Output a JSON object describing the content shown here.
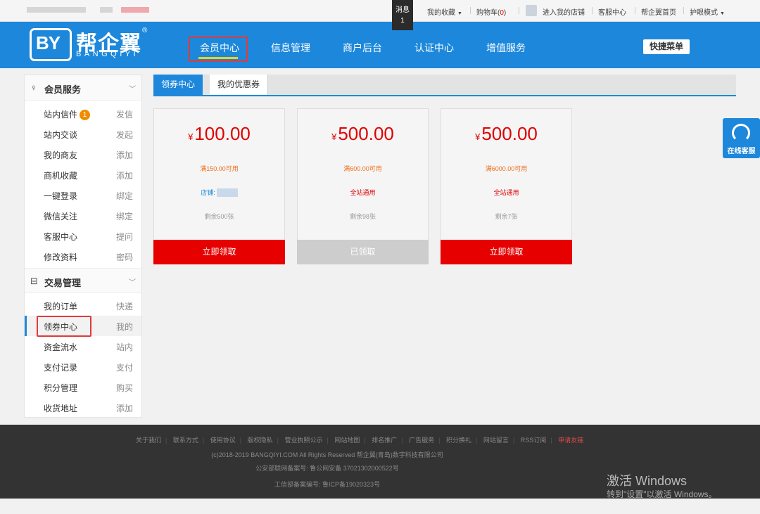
{
  "topbar": {
    "msg_label": "消息",
    "msg_count": "1",
    "my_fav": "我的收藏",
    "cart_label": "购物车(",
    "cart_count": "0",
    "cart_close": ")",
    "enter_shop": "进入我的店铺",
    "service": "客服中心",
    "home": "帮企翼首页",
    "eye_mode": "护眼模式"
  },
  "header": {
    "logo_mark": "BY",
    "logo_cn": "帮企翼",
    "logo_en": "BANGQIYI",
    "logo_reg": "®",
    "nav": [
      "会员中心",
      "信息管理",
      "商户后台",
      "认证中心",
      "增值服务"
    ],
    "quick_menu": "快捷菜单"
  },
  "sidebar": {
    "section1": {
      "title": "会员服务",
      "icon": "user-icon"
    },
    "items1": [
      {
        "label": "站内信件",
        "badge": "1",
        "action": "发信"
      },
      {
        "label": "站内交谈",
        "action": "发起"
      },
      {
        "label": "我的商友",
        "action": "添加"
      },
      {
        "label": "商机收藏",
        "action": "添加"
      },
      {
        "label": "一键登录",
        "action": "绑定"
      },
      {
        "label": "微信关注",
        "action": "绑定"
      },
      {
        "label": "客服中心",
        "action": "提问"
      },
      {
        "label": "修改资料",
        "action": "密码"
      }
    ],
    "section2": {
      "title": "交易管理",
      "icon": "order-icon"
    },
    "items2": [
      {
        "label": "我的订单",
        "action": "快递"
      },
      {
        "label": "领券中心",
        "action": "我的"
      },
      {
        "label": "资金流水",
        "action": "站内"
      },
      {
        "label": "支付记录",
        "action": "支付"
      },
      {
        "label": "积分管理",
        "action": "购买"
      },
      {
        "label": "收货地址",
        "action": "添加"
      }
    ]
  },
  "tabs": [
    "领券中心",
    "我的优惠券"
  ],
  "coupons": [
    {
      "currency": "¥",
      "amount": "100.00",
      "condition": "满150.00可用",
      "scope": "店铺:",
      "remaining": "剩余500张",
      "button": "立即领取"
    },
    {
      "currency": "¥",
      "amount": "500.00",
      "condition": "满600.00可用",
      "scope": "全站通用",
      "remaining": "剩余98张",
      "button": "已领取"
    },
    {
      "currency": "¥",
      "amount": "500.00",
      "condition": "满6000.00可用",
      "scope": "全站通用",
      "remaining": "剩余7张",
      "button": "立即领取"
    }
  ],
  "kefu": "在线客服",
  "footer": {
    "links": [
      "关于我们",
      "联系方式",
      "使用协议",
      "版权隐私",
      "营业执照公示",
      "网站地图",
      "排名推广",
      "广告服务",
      "积分换礼",
      "网站留言",
      "RSS订阅",
      "申请友链"
    ],
    "copyright": "(c)2018-2019 BANGQIYI.COM All Rights Reserved 帮企翼(青岛)数字科技有限公司",
    "police": "公安部联网备案号: 鲁公网安备 37021302000522号",
    "icp": "工信部备案编号: 鲁ICP备19020323号"
  },
  "windows": {
    "line1": "激活 Windows",
    "line2": "转到\"设置\"以激活 Windows。"
  },
  "colors": {
    "brand_blue": "#1d88db",
    "coupon_red": "#e60000",
    "condition_orange": "#ef6f1b",
    "highlight_box": "#e03a3a"
  }
}
